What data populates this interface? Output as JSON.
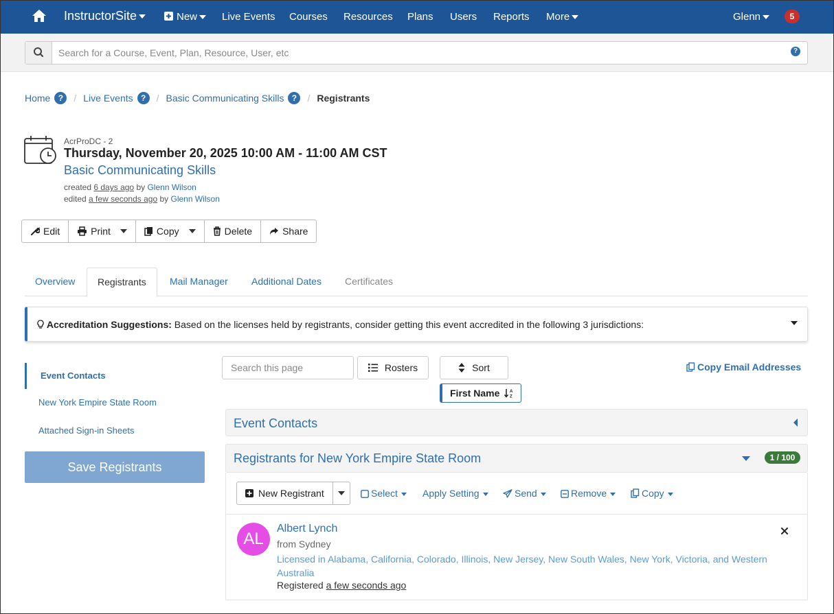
{
  "nav": {
    "brand": "InstructorSite",
    "items": [
      {
        "label": "New",
        "caret": true
      },
      {
        "label": "Live Events"
      },
      {
        "label": "Courses"
      },
      {
        "label": "Resources"
      },
      {
        "label": "Plans"
      },
      {
        "label": "Users"
      },
      {
        "label": "Reports"
      },
      {
        "label": "More",
        "caret": true
      }
    ],
    "user": "Glenn",
    "notifications": "5",
    "color": "#1d5596"
  },
  "search": {
    "placeholder": "Search for a Course, Event, Plan, Resource, User, etc",
    "value": ""
  },
  "breadcrumb": {
    "home": "Home",
    "live_events": "Live Events",
    "event": "Basic Communicating Skills",
    "current": "Registrants"
  },
  "event": {
    "code": "AcrProDC - 2",
    "datetime": "Thursday, November 20, 2025 10:00 AM - 11:00 AM CST",
    "title": "Basic Communicating Skills",
    "created_prefix": "created",
    "created_when": "6 days ago",
    "created_by_prefix": "by",
    "created_by": "Glenn Wilson",
    "edited_prefix": "edited",
    "edited_when": "a few seconds ago",
    "edited_by_prefix": "by",
    "edited_by": "Glenn Wilson"
  },
  "actions": {
    "edit": "Edit",
    "print": "Print",
    "copy": "Copy",
    "delete": "Delete",
    "share": "Share"
  },
  "tabs": {
    "overview": "Overview",
    "registrants": "Registrants",
    "mail_manager": "Mail Manager",
    "additional_dates": "Additional Dates",
    "certificates": "Certificates"
  },
  "accreditation": {
    "label": "Accreditation Suggestions:",
    "text": " Based on the licenses held by registrants, consider getting this event accredited in the following 3 jurisdictions:"
  },
  "sidenav": {
    "items": [
      "Event Contacts",
      "New York Empire State Room",
      "Attached Sign-in Sheets"
    ],
    "save": "Save Registrants"
  },
  "toolbar": {
    "search_placeholder": "Search this page",
    "rosters": "Rosters",
    "sort": "Sort",
    "sort_field": "First Name",
    "copy_emails": "Copy Email Addresses"
  },
  "panels": {
    "contacts_title": "Event Contacts",
    "registrants_title": "Registrants for New York Empire State Room",
    "registrants_count": "1 / 100"
  },
  "reg_toolbar": {
    "new_registrant": "New Registrant",
    "select": "Select",
    "apply_setting": "Apply Setting",
    "send": "Send",
    "remove": "Remove",
    "copy": "Copy"
  },
  "registrant": {
    "initials": "AL",
    "name": "Albert Lynch",
    "from": "from Sydney",
    "licensed": "Licensed in Alabama, California, Colorado, Illinois, New Jersey, New South Wales, New York, Victoria, and Western Australia",
    "registered_prefix": "Registered",
    "registered_when": "a few seconds ago",
    "avatar_color": "#e64de6"
  }
}
